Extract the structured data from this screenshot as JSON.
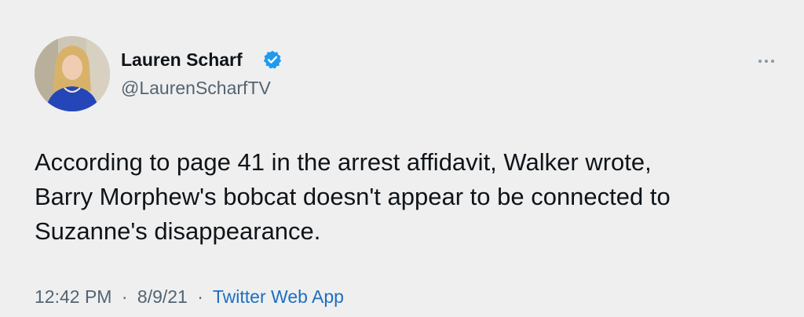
{
  "author": {
    "name": "Lauren Scharf",
    "handle": "@LaurenScharfTV",
    "verified": true
  },
  "tweet": {
    "lines": [
      "According to page 41 in the arrest affidavit, Walker wrote,",
      "Barry Morphew's bobcat doesn't appear to be connected to",
      "Suzanne's disappearance."
    ]
  },
  "meta": {
    "time": "12:42 PM",
    "separator": "·",
    "date": "8/9/21",
    "source": "Twitter Web App"
  },
  "icons": {
    "verified": "verified-badge-icon",
    "more": "more-options-icon"
  },
  "colors": {
    "background": "#efefef",
    "text": "#0f1419",
    "muted": "#536471",
    "link": "#1d6fc0",
    "verified": "#1d9bf0"
  }
}
